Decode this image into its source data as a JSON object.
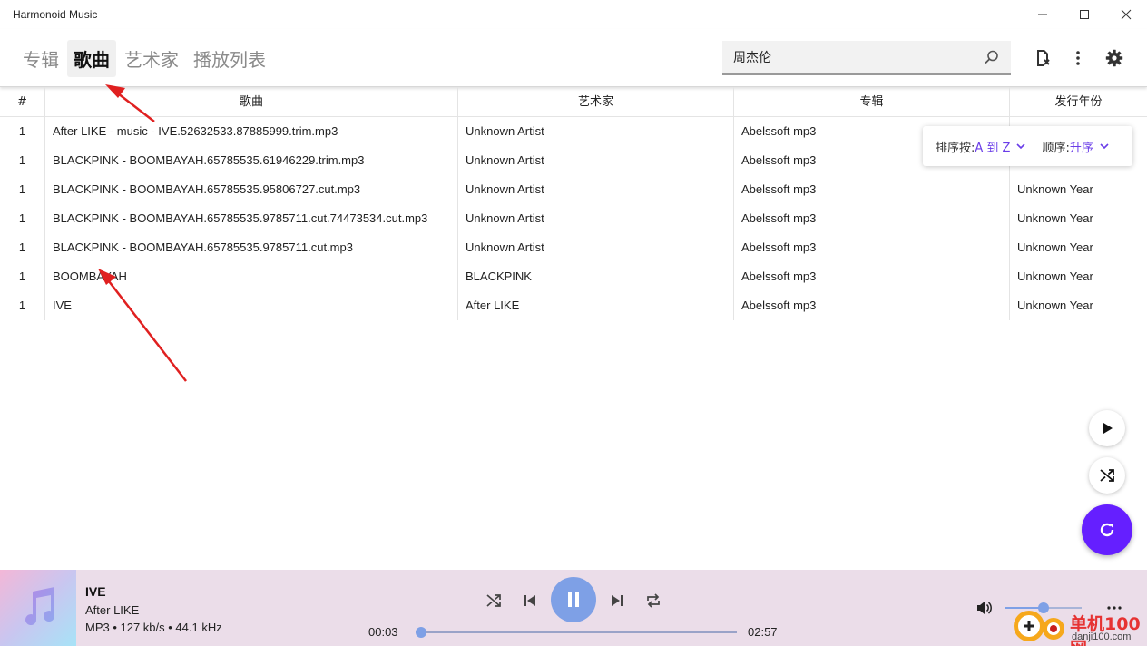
{
  "window": {
    "title": "Harmonoid Music",
    "minimize_glyph": "—",
    "maximize_glyph": "☐",
    "close_glyph": "✕"
  },
  "tabs": [
    {
      "label": "专辑",
      "active": false
    },
    {
      "label": "歌曲",
      "active": true
    },
    {
      "label": "艺术家",
      "active": false
    },
    {
      "label": "播放列表",
      "active": false
    }
  ],
  "search": {
    "value": "周杰伦",
    "icon": "search-icon"
  },
  "header_icons": [
    "file-import-icon",
    "more-vert-icon",
    "settings-icon"
  ],
  "table": {
    "headers": [
      "#",
      "歌曲",
      "艺术家",
      "专辑",
      "发行年份"
    ],
    "rows": [
      {
        "num": "1",
        "song": "After LIKE - music - IVE.52632533.87885999.trim.mp3",
        "artist": "Unknown Artist",
        "album": "Abelssoft mp3",
        "year": ""
      },
      {
        "num": "1",
        "song": "BLACKPINK - BOOMBAYAH.65785535.61946229.trim.mp3",
        "artist": "Unknown Artist",
        "album": "Abelssoft mp3",
        "year": ""
      },
      {
        "num": "1",
        "song": "BLACKPINK - BOOMBAYAH.65785535.95806727.cut.mp3",
        "artist": "Unknown Artist",
        "album": "Abelssoft mp3",
        "year": "Unknown Year"
      },
      {
        "num": "1",
        "song": "BLACKPINK - BOOMBAYAH.65785535.9785711.cut.74473534.cut.mp3",
        "artist": "Unknown Artist",
        "album": "Abelssoft mp3",
        "year": "Unknown Year"
      },
      {
        "num": "1",
        "song": "BLACKPINK - BOOMBAYAH.65785535.9785711.cut.mp3",
        "artist": "Unknown Artist",
        "album": "Abelssoft mp3",
        "year": "Unknown Year"
      },
      {
        "num": "1",
        "song": "BOOMBAYAH",
        "artist": "BLACKPINK",
        "album": "Abelssoft mp3",
        "year": "Unknown Year"
      },
      {
        "num": "1",
        "song": "IVE",
        "artist": "After LIKE",
        "album": "Abelssoft mp3",
        "year": "Unknown Year"
      }
    ]
  },
  "sort": {
    "sort_label": "排序按: ",
    "sort_value": "A 到 Z",
    "order_label": "顺序: ",
    "order_value": "升序"
  },
  "fabs": [
    "play-icon",
    "shuffle-icon",
    "refresh-icon"
  ],
  "player": {
    "title": "IVE",
    "artist": "After LIKE",
    "meta": "MP3 • 127 kb/s • 44.1 kHz",
    "current_time": "00:03",
    "total_time": "02:57",
    "progress": 0.017,
    "volume": 0.5,
    "playing": true
  },
  "watermark": {
    "cn": "单机100网",
    "en": "danji100.com"
  },
  "colors": {
    "accent": "#651fff",
    "sort_value": "#6a3de8",
    "player_bg": "#ebdde9",
    "player_accent": "#7ea0e6",
    "annotation_arrow": "#e02020"
  }
}
